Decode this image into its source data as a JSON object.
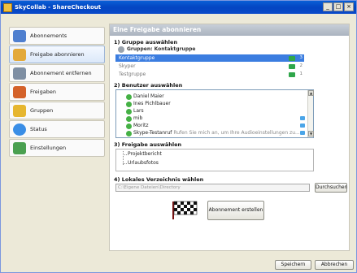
{
  "window": {
    "title": "SkyCollab - ShareCheckout",
    "minimize": "_",
    "maximize": "□",
    "close": "×"
  },
  "sidebar": {
    "items": [
      {
        "label": "Abonnements",
        "color": "#4f7fcf"
      },
      {
        "label": "Freigabe abonnieren",
        "color": "#e3a93a"
      },
      {
        "label": "Abonnement entfernen",
        "color": "#7f8fa3"
      },
      {
        "label": "Freigaben",
        "color": "#d4622a"
      },
      {
        "label": "Gruppen",
        "color": "#e6b62f"
      },
      {
        "label": "Status",
        "color": "#3a8ee6"
      },
      {
        "label": "Einstellungen",
        "color": "#4aa050"
      }
    ]
  },
  "panel": {
    "header": "Eine Freigabe abonnieren",
    "group": {
      "title": "1) Gruppe auswählen",
      "selected_label": "Gruppen: Kontaktgruppe",
      "rows": [
        {
          "name": "Kontaktgruppe",
          "count": "3"
        },
        {
          "name": "Skyper",
          "count": "2"
        },
        {
          "name": "Testgruppe",
          "count": "1"
        }
      ]
    },
    "users": {
      "title": "2) Benutzer auswählen",
      "rows": [
        {
          "name": "Daniel Maier"
        },
        {
          "name": "Ines Pichlbauer"
        },
        {
          "name": "Lars"
        },
        {
          "name": "mib"
        },
        {
          "name": "Moritz"
        },
        {
          "name": "Skype-Testanruf",
          "note": "Rufen Sie mich an, um Ihre Audioeinstellungen zu..."
        }
      ],
      "scroll_up": "▲",
      "scroll_down": "▼"
    },
    "share": {
      "title": "3) Freigabe auswählen",
      "items": [
        "Projektbericht",
        "Urlaubsfotos"
      ]
    },
    "folder": {
      "title": "4) Lokales Verzeichnis wählen",
      "path": "C:\\Eigene Dateien\\Directory",
      "browse_label": "Durchsuchen"
    },
    "create_label": "Abonnement erstellen"
  },
  "footer": {
    "save_label": "Speichern",
    "cancel_label": "Abbrechen"
  },
  "colors": {
    "selection": "#3b7de0",
    "online": "#45b145",
    "header": "#aab3bf"
  }
}
